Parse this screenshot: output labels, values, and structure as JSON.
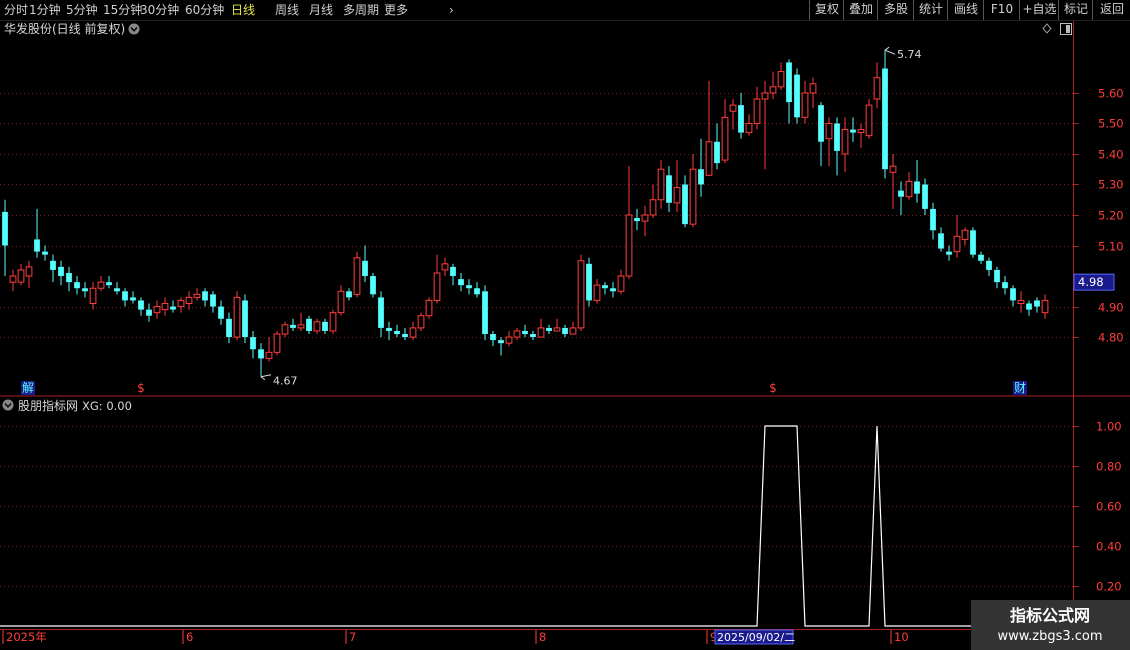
{
  "toolbar": {
    "periods": [
      "分时",
      "1分钟",
      "5分钟",
      "15分钟",
      "30分钟",
      "60分钟",
      "日线",
      "周线",
      "月线",
      "多周期",
      "更多"
    ],
    "active_period": "日线",
    "right_buttons": [
      "复权",
      "叠加",
      "多股",
      "统计",
      "画线",
      "F10",
      "+自选",
      "标记",
      "返回"
    ]
  },
  "main_chart": {
    "title": "华发股份(日线 前复权)",
    "price_axis_ticks": [
      "5.60",
      "5.50",
      "5.40",
      "5.30",
      "5.20",
      "5.10",
      "4.90",
      "4.80"
    ],
    "current_price": "4.98",
    "high_label": "5.74",
    "low_label": "4.67",
    "event_markers": [
      "解",
      "$",
      "$",
      "财"
    ]
  },
  "indicator_panel": {
    "title": "股朋指标网",
    "xg_label": "XG: 0.00",
    "axis_ticks": [
      "1.00",
      "0.80",
      "0.60",
      "0.40",
      "0.20"
    ]
  },
  "date_axis": {
    "labels": [
      "2025年",
      "6",
      "7",
      "8",
      "9",
      "10"
    ],
    "cursor_date": "2025/09/02/二"
  },
  "watermark": {
    "line1": "指标公式网",
    "line2": "www.zbgs3.com"
  },
  "colors": {
    "up": "#ff3d3d",
    "down": "#54ffff",
    "grid": "#7a1a1a",
    "axis": "#aa2222",
    "toolbar_active": "#e6e64a"
  },
  "chart_data": {
    "type": "candlestick",
    "ylim": [
      4.62,
      5.78
    ],
    "candles": [
      [
        5.21,
        5.1,
        5.25,
        5.0
      ],
      [
        4.98,
        5.0,
        5.02,
        4.95
      ],
      [
        4.98,
        5.02,
        5.04,
        4.97
      ],
      [
        5.0,
        5.03,
        5.05,
        4.96
      ],
      [
        5.12,
        5.08,
        5.22,
        5.06
      ],
      [
        5.08,
        5.07,
        5.1,
        5.05
      ],
      [
        5.05,
        5.02,
        5.07,
        4.98
      ],
      [
        5.03,
        5.0,
        5.05,
        4.97
      ],
      [
        5.01,
        4.98,
        5.03,
        4.95
      ],
      [
        4.98,
        4.96,
        5.0,
        4.94
      ],
      [
        4.96,
        4.95,
        4.98,
        4.93
      ],
      [
        4.91,
        4.96,
        4.98,
        4.89
      ],
      [
        4.96,
        4.98,
        5.0,
        4.95
      ],
      [
        4.98,
        4.97,
        5.0,
        4.96
      ],
      [
        4.96,
        4.95,
        4.98,
        4.94
      ],
      [
        4.95,
        4.92,
        4.96,
        4.9
      ],
      [
        4.93,
        4.92,
        4.95,
        4.91
      ],
      [
        4.92,
        4.89,
        4.93,
        4.87
      ],
      [
        4.89,
        4.87,
        4.91,
        4.85
      ],
      [
        4.88,
        4.9,
        4.92,
        4.86
      ],
      [
        4.89,
        4.91,
        4.93,
        4.87
      ],
      [
        4.9,
        4.89,
        4.92,
        4.88
      ],
      [
        4.9,
        4.92,
        4.93,
        4.88
      ],
      [
        4.91,
        4.93,
        4.95,
        4.89
      ],
      [
        4.93,
        4.94,
        4.96,
        4.92
      ],
      [
        4.95,
        4.92,
        4.96,
        4.9
      ],
      [
        4.94,
        4.9,
        4.95,
        4.88
      ],
      [
        4.9,
        4.86,
        4.92,
        4.84
      ],
      [
        4.86,
        4.8,
        4.88,
        4.78
      ],
      [
        4.8,
        4.93,
        4.95,
        4.79
      ],
      [
        4.92,
        4.8,
        4.94,
        4.78
      ],
      [
        4.8,
        4.76,
        4.82,
        4.73
      ],
      [
        4.76,
        4.73,
        4.78,
        4.67
      ],
      [
        4.73,
        4.75,
        4.8,
        4.72
      ],
      [
        4.75,
        4.81,
        4.82,
        4.74
      ],
      [
        4.81,
        4.84,
        4.85,
        4.8
      ],
      [
        4.84,
        4.83,
        4.86,
        4.82
      ],
      [
        4.83,
        4.84,
        4.88,
        4.82
      ],
      [
        4.86,
        4.82,
        4.87,
        4.81
      ],
      [
        4.82,
        4.85,
        4.86,
        4.81
      ],
      [
        4.85,
        4.82,
        4.86,
        4.81
      ],
      [
        4.82,
        4.88,
        4.89,
        4.81
      ],
      [
        4.88,
        4.95,
        4.97,
        4.87
      ],
      [
        4.95,
        4.93,
        4.96,
        4.92
      ],
      [
        4.94,
        5.06,
        5.08,
        4.93
      ],
      [
        5.05,
        5.0,
        5.1,
        4.98
      ],
      [
        5.0,
        4.94,
        5.01,
        4.93
      ],
      [
        4.93,
        4.83,
        4.95,
        4.8
      ],
      [
        4.83,
        4.82,
        4.85,
        4.79
      ],
      [
        4.82,
        4.81,
        4.84,
        4.8
      ],
      [
        4.81,
        4.8,
        4.83,
        4.79
      ],
      [
        4.8,
        4.83,
        4.85,
        4.79
      ],
      [
        4.83,
        4.87,
        4.88,
        4.82
      ],
      [
        4.87,
        4.92,
        4.93,
        4.86
      ],
      [
        4.92,
        5.01,
        5.07,
        4.91
      ],
      [
        5.02,
        5.04,
        5.06,
        5.0
      ],
      [
        5.03,
        5.0,
        5.04,
        4.97
      ],
      [
        4.99,
        4.97,
        5.01,
        4.95
      ],
      [
        4.97,
        4.96,
        4.99,
        4.94
      ],
      [
        4.96,
        4.94,
        4.98,
        4.93
      ],
      [
        4.95,
        4.81,
        4.97,
        4.79
      ],
      [
        4.81,
        4.79,
        4.82,
        4.77
      ],
      [
        4.79,
        4.78,
        4.8,
        4.74
      ],
      [
        4.78,
        4.8,
        4.82,
        4.77
      ],
      [
        4.8,
        4.82,
        4.83,
        4.79
      ],
      [
        4.82,
        4.81,
        4.84,
        4.8
      ],
      [
        4.81,
        4.8,
        4.82,
        4.79
      ],
      [
        4.8,
        4.83,
        4.86,
        4.8
      ],
      [
        4.83,
        4.82,
        4.84,
        4.81
      ],
      [
        4.82,
        4.83,
        4.86,
        4.82
      ],
      [
        4.83,
        4.81,
        4.84,
        4.8
      ],
      [
        4.81,
        4.83,
        4.85,
        4.81
      ],
      [
        4.83,
        5.05,
        5.07,
        4.82
      ],
      [
        5.04,
        4.92,
        5.06,
        4.9
      ],
      [
        4.92,
        4.97,
        4.99,
        4.91
      ],
      [
        4.97,
        4.96,
        4.98,
        4.94
      ],
      [
        4.96,
        4.95,
        4.98,
        4.93
      ],
      [
        4.95,
        5.0,
        5.02,
        4.94
      ],
      [
        5.0,
        5.2,
        5.36,
        4.99
      ],
      [
        5.19,
        5.18,
        5.22,
        5.15
      ],
      [
        5.18,
        5.2,
        5.23,
        5.13
      ],
      [
        5.2,
        5.25,
        5.3,
        5.19
      ],
      [
        5.25,
        5.35,
        5.38,
        5.22
      ],
      [
        5.33,
        5.24,
        5.36,
        5.21
      ],
      [
        5.24,
        5.29,
        5.38,
        5.21
      ],
      [
        5.3,
        5.17,
        5.33,
        5.16
      ],
      [
        5.17,
        5.35,
        5.4,
        5.16
      ],
      [
        5.35,
        5.3,
        5.45,
        5.26
      ],
      [
        5.33,
        5.44,
        5.64,
        5.33
      ],
      [
        5.44,
        5.37,
        5.5,
        5.35
      ],
      [
        5.38,
        5.52,
        5.58,
        5.37
      ],
      [
        5.54,
        5.56,
        5.58,
        5.48
      ],
      [
        5.56,
        5.47,
        5.6,
        5.45
      ],
      [
        5.47,
        5.5,
        5.53,
        5.46
      ],
      [
        5.5,
        5.58,
        5.62,
        5.48
      ],
      [
        5.58,
        5.6,
        5.64,
        5.35
      ],
      [
        5.6,
        5.62,
        5.67,
        5.58
      ],
      [
        5.62,
        5.67,
        5.7,
        5.61
      ],
      [
        5.7,
        5.57,
        5.71,
        5.5
      ],
      [
        5.66,
        5.52,
        5.68,
        5.5
      ],
      [
        5.52,
        5.6,
        5.64,
        5.5
      ],
      [
        5.6,
        5.63,
        5.65,
        5.55
      ],
      [
        5.56,
        5.44,
        5.57,
        5.36
      ],
      [
        5.45,
        5.5,
        5.52,
        5.36
      ],
      [
        5.5,
        5.41,
        5.52,
        5.33
      ],
      [
        5.4,
        5.48,
        5.52,
        5.34
      ],
      [
        5.48,
        5.47,
        5.52,
        5.44
      ],
      [
        5.47,
        5.48,
        5.5,
        5.42
      ],
      [
        5.46,
        5.56,
        5.58,
        5.45
      ],
      [
        5.58,
        5.65,
        5.7,
        5.55
      ],
      [
        5.68,
        5.35,
        5.74,
        5.32
      ],
      [
        5.34,
        5.36,
        5.4,
        5.22
      ],
      [
        5.28,
        5.26,
        5.31,
        5.2
      ],
      [
        5.26,
        5.31,
        5.34,
        5.25
      ],
      [
        5.31,
        5.27,
        5.38,
        5.24
      ],
      [
        5.3,
        5.22,
        5.32,
        5.2
      ],
      [
        5.22,
        5.15,
        5.24,
        5.12
      ],
      [
        5.14,
        5.09,
        5.16,
        5.08
      ],
      [
        5.08,
        5.07,
        5.1,
        5.05
      ],
      [
        5.08,
        5.13,
        5.2,
        5.06
      ],
      [
        5.12,
        5.15,
        5.16,
        5.1
      ],
      [
        5.15,
        5.07,
        5.16,
        5.06
      ],
      [
        5.07,
        5.05,
        5.08,
        5.04
      ],
      [
        5.05,
        5.02,
        5.06,
        5.0
      ],
      [
        5.02,
        4.98,
        5.03,
        4.96
      ],
      [
        4.98,
        4.96,
        5.0,
        4.94
      ],
      [
        4.96,
        4.92,
        4.97,
        4.9
      ],
      [
        4.91,
        4.92,
        4.95,
        4.88
      ],
      [
        4.91,
        4.89,
        4.92,
        4.87
      ],
      [
        4.92,
        4.9,
        4.93,
        4.88
      ],
      [
        4.88,
        4.92,
        4.94,
        4.86
      ]
    ],
    "xg_signal": {
      "type": "line",
      "ylim": [
        0,
        1.05
      ],
      "pulses": [
        {
          "from_candle": 95,
          "to_candle": 99,
          "value": 1.0
        },
        {
          "from_candle": 109,
          "to_candle": 109,
          "value": 1.0
        }
      ]
    }
  }
}
